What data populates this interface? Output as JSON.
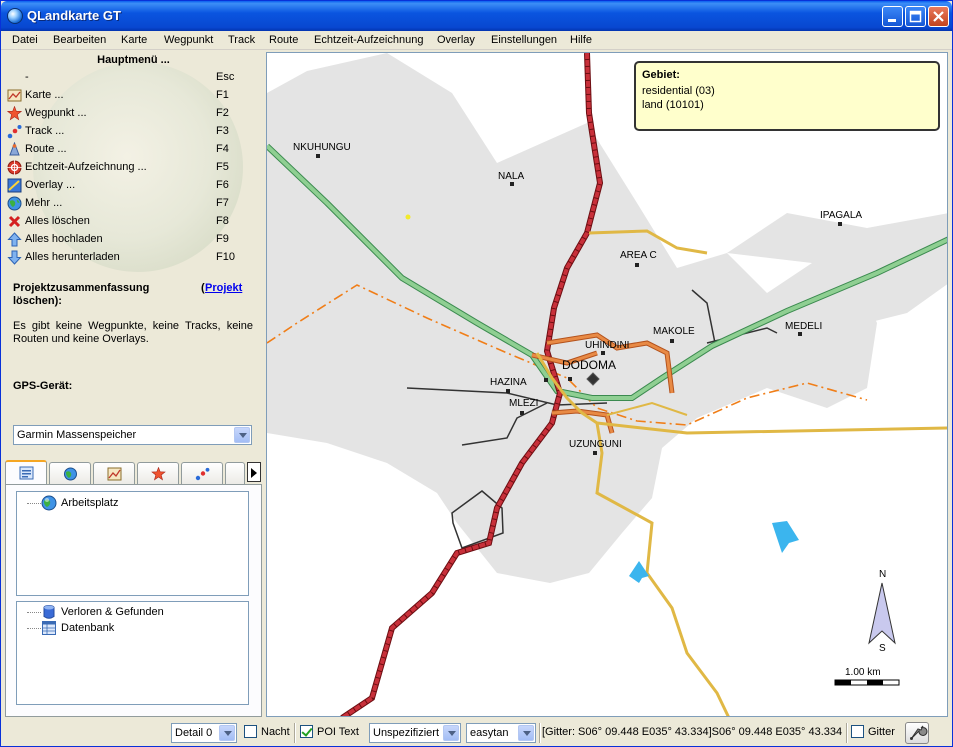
{
  "window": {
    "title": "QLandkarte GT"
  },
  "menubar": [
    {
      "label": "Datei"
    },
    {
      "label": "Bearbeiten"
    },
    {
      "label": "Karte"
    },
    {
      "label": "Wegpunkt"
    },
    {
      "label": "Track"
    },
    {
      "label": "Route"
    },
    {
      "label": "Echtzeit-Aufzeichnung"
    },
    {
      "label": "Overlay"
    },
    {
      "label": "Einstellungen"
    },
    {
      "label": "Hilfe"
    }
  ],
  "main_menu": {
    "title": "Hauptmenü ...",
    "items": [
      {
        "label": "-",
        "key": "Esc",
        "icon": "none"
      },
      {
        "label": "Karte ...",
        "key": "F1",
        "icon": "map-icon"
      },
      {
        "label": "Wegpunkt ...",
        "key": "F2",
        "icon": "star-icon"
      },
      {
        "label": "Track ...",
        "key": "F3",
        "icon": "track-icon"
      },
      {
        "label": "Route ...",
        "key": "F4",
        "icon": "route-icon"
      },
      {
        "label": "Echtzeit-Aufzeichnung ...",
        "key": "F5",
        "icon": "live-log-icon"
      },
      {
        "label": "Overlay ...",
        "key": "F6",
        "icon": "overlay-icon"
      },
      {
        "label": "Mehr ...",
        "key": "F7",
        "icon": "globe-icon"
      },
      {
        "label": "Alles löschen",
        "key": "F8",
        "icon": "delete-icon"
      },
      {
        "label": "Alles hochladen",
        "key": "F9",
        "icon": "upload-icon"
      },
      {
        "label": "Alles herunterladen",
        "key": "F10",
        "icon": "download-icon"
      }
    ]
  },
  "project": {
    "title": "Projektzusammenfassung löschen):",
    "link_open": "(",
    "link": "Projekt",
    "text": "Es gibt keine Wegpunkte, keine Tracks, keine Routen und keine Overlays."
  },
  "gps": {
    "title": "GPS-Gerät:",
    "device": "Garmin Massenspeicher"
  },
  "tree_top": {
    "items": [
      {
        "label": "Arbeitsplatz",
        "icon": "workspace-icon"
      }
    ]
  },
  "tree_bottom": {
    "items": [
      {
        "label": "Verloren & Gefunden",
        "icon": "database-icon"
      },
      {
        "label": "Datenbank",
        "icon": "table-icon"
      }
    ]
  },
  "map": {
    "places": [
      {
        "name": "NKUHUNGU"
      },
      {
        "name": "NALA"
      },
      {
        "name": "IPAGALA"
      },
      {
        "name": "AREA C"
      },
      {
        "name": "MAKOLE"
      },
      {
        "name": "MEDELI"
      },
      {
        "name": "UHINDINI"
      },
      {
        "name": "DODOMA"
      },
      {
        "name": "HAZINA"
      },
      {
        "name": "MLEZI"
      },
      {
        "name": "UZUNGUNI"
      }
    ],
    "info": {
      "title": "Gebiet:",
      "lines": [
        "residential (03)",
        "land (10101)"
      ]
    },
    "compass": {
      "north": "N",
      "south": "S"
    },
    "scale": "1.00 km"
  },
  "statusbar": {
    "detail": "Detail  0",
    "night": "Nacht",
    "night_checked": false,
    "poi": "POI Text",
    "poi_checked": true,
    "projection": "Unspezifiziert",
    "typ": "easytan",
    "coords": "[Gitter: S06° 09.448 E035° 43.334]S06° 09.448 E035° 43.334",
    "grid": "Gitter",
    "grid_checked": false
  }
}
